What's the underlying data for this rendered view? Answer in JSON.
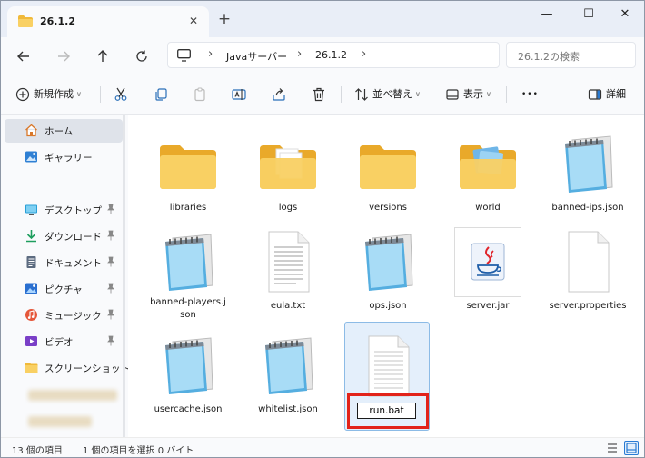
{
  "window": {
    "tab_title": "26.1.2",
    "tab_close": "✕",
    "tab_add": "+",
    "minimize": "—",
    "maximize": "☐",
    "close": "✕"
  },
  "address": {
    "crumbs": [
      "Javaサーバー",
      "26.1.2"
    ],
    "search_placeholder": "26.1.2の検索"
  },
  "toolbar": {
    "new_label": "新規作成",
    "sort_label": "並べ替え",
    "view_label": "表示",
    "more_label": "•••",
    "details_label": "詳細"
  },
  "sidebar": {
    "items": [
      {
        "label": "ホーム",
        "icon": "home-icon"
      },
      {
        "label": "ギャラリー",
        "icon": "gallery-icon"
      },
      {
        "label": "デスクトップ",
        "icon": "desktop-icon"
      },
      {
        "label": "ダウンロード",
        "icon": "download-icon"
      },
      {
        "label": "ドキュメント",
        "icon": "documents-icon"
      },
      {
        "label": "ピクチャ",
        "icon": "pictures-icon"
      },
      {
        "label": "ミュージック",
        "icon": "music-icon"
      },
      {
        "label": "ビデオ",
        "icon": "videos-icon"
      },
      {
        "label": "スクリーンショット",
        "icon": "folder-icon"
      }
    ]
  },
  "files": [
    {
      "name": "libraries",
      "type": "folder"
    },
    {
      "name": "logs",
      "type": "folder-docs"
    },
    {
      "name": "versions",
      "type": "folder"
    },
    {
      "name": "world",
      "type": "folder-images"
    },
    {
      "name": "banned-ips.json",
      "type": "notepad"
    },
    {
      "name": "banned-players.json",
      "line1": "banned-players.j",
      "line2": "son",
      "type": "notepad"
    },
    {
      "name": "eula.txt",
      "type": "text"
    },
    {
      "name": "ops.json",
      "type": "notepad"
    },
    {
      "name": "server.jar",
      "type": "java"
    },
    {
      "name": "server.properties",
      "type": "blank"
    },
    {
      "name": "usercache.json",
      "type": "notepad"
    },
    {
      "name": "whitelist.json",
      "type": "notepad"
    },
    {
      "name": "run.bat",
      "type": "blank-lines",
      "renaming": true
    }
  ],
  "rename_value": "run.bat",
  "status": {
    "count": "13 個の項目",
    "selection": "1 個の項目を選択  0 バイト"
  },
  "colors": {
    "accent": "#2a7bd3",
    "highlight": "#e2231a",
    "folder": "#f4c74e"
  }
}
